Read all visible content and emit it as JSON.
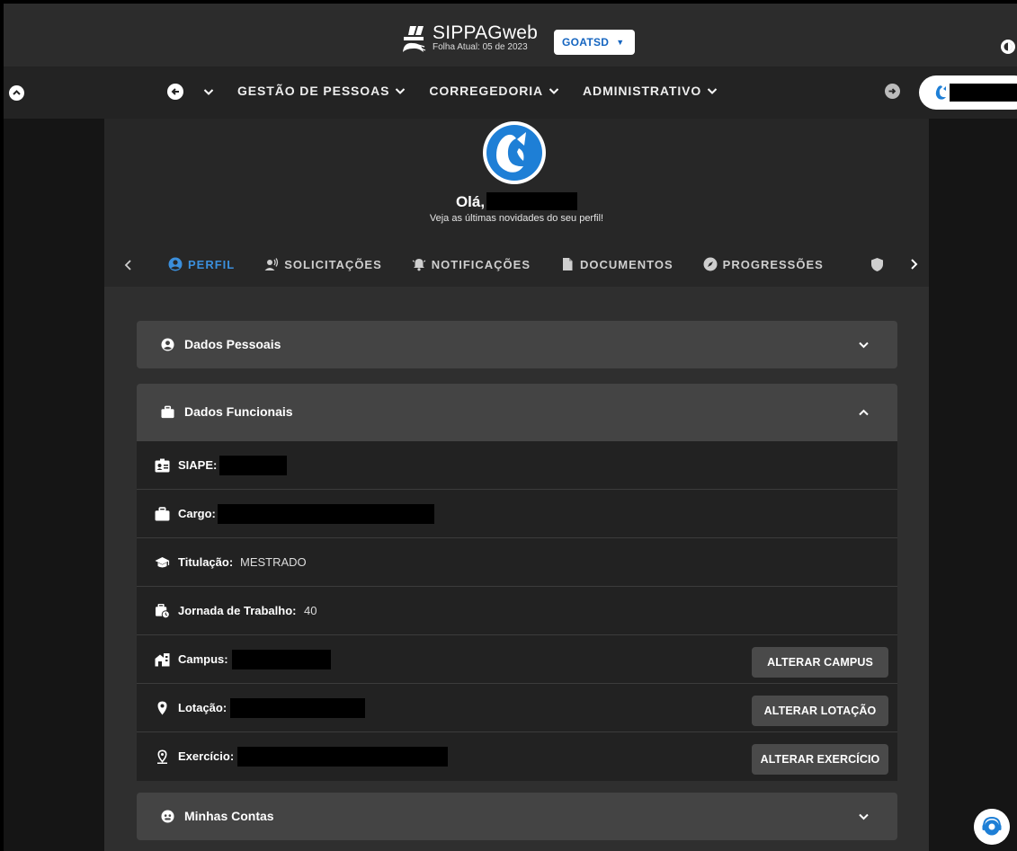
{
  "app": {
    "name": "SIPPAGweb",
    "folha": "Folha Atual: 05 de 2023",
    "org": "GOATSD"
  },
  "nav": {
    "items": [
      {
        "label": "GESTÃO DE PESSOAS"
      },
      {
        "label": "CORREGEDORIA"
      },
      {
        "label": "ADMINISTRATIVO"
      }
    ]
  },
  "profile": {
    "greeting": "Olá,",
    "subtitle": "Veja as últimas novidades do seu perfil!"
  },
  "tabs": [
    {
      "label": "PERFIL",
      "icon": "user-circle-icon"
    },
    {
      "label": "SOLICITAÇÕES",
      "icon": "user-voice-icon"
    },
    {
      "label": "NOTIFICAÇÕES",
      "icon": "bell-icon"
    },
    {
      "label": "DOCUMENTOS",
      "icon": "document-icon"
    },
    {
      "label": "PROGRESSÕES",
      "icon": "compass-icon"
    }
  ],
  "panels": {
    "dados_pessoais": {
      "title": "Dados Pessoais"
    },
    "dados_funcionais": {
      "title": "Dados Funcionais",
      "rows": {
        "siape": {
          "label": "SIAPE:"
        },
        "cargo": {
          "label": "Cargo:"
        },
        "titulacao": {
          "label": "Titulação:",
          "value": "MESTRADO"
        },
        "jornada": {
          "label": "Jornada de Trabalho:",
          "value": "40"
        },
        "campus": {
          "label": "Campus:",
          "button": "ALTERAR CAMPUS"
        },
        "lotacao": {
          "label": "Lotação:",
          "button": "ALTERAR LOTAÇÃO"
        },
        "exercicio": {
          "label": "Exercício:",
          "button": "ALTERAR EXERCÍCIO"
        }
      }
    },
    "minhas_contas": {
      "title": "Minhas Contas"
    }
  },
  "colors": {
    "accent": "#3b8fdc",
    "org_badge_text": "#1565c0",
    "background": "#161616",
    "panel": "#444444"
  }
}
